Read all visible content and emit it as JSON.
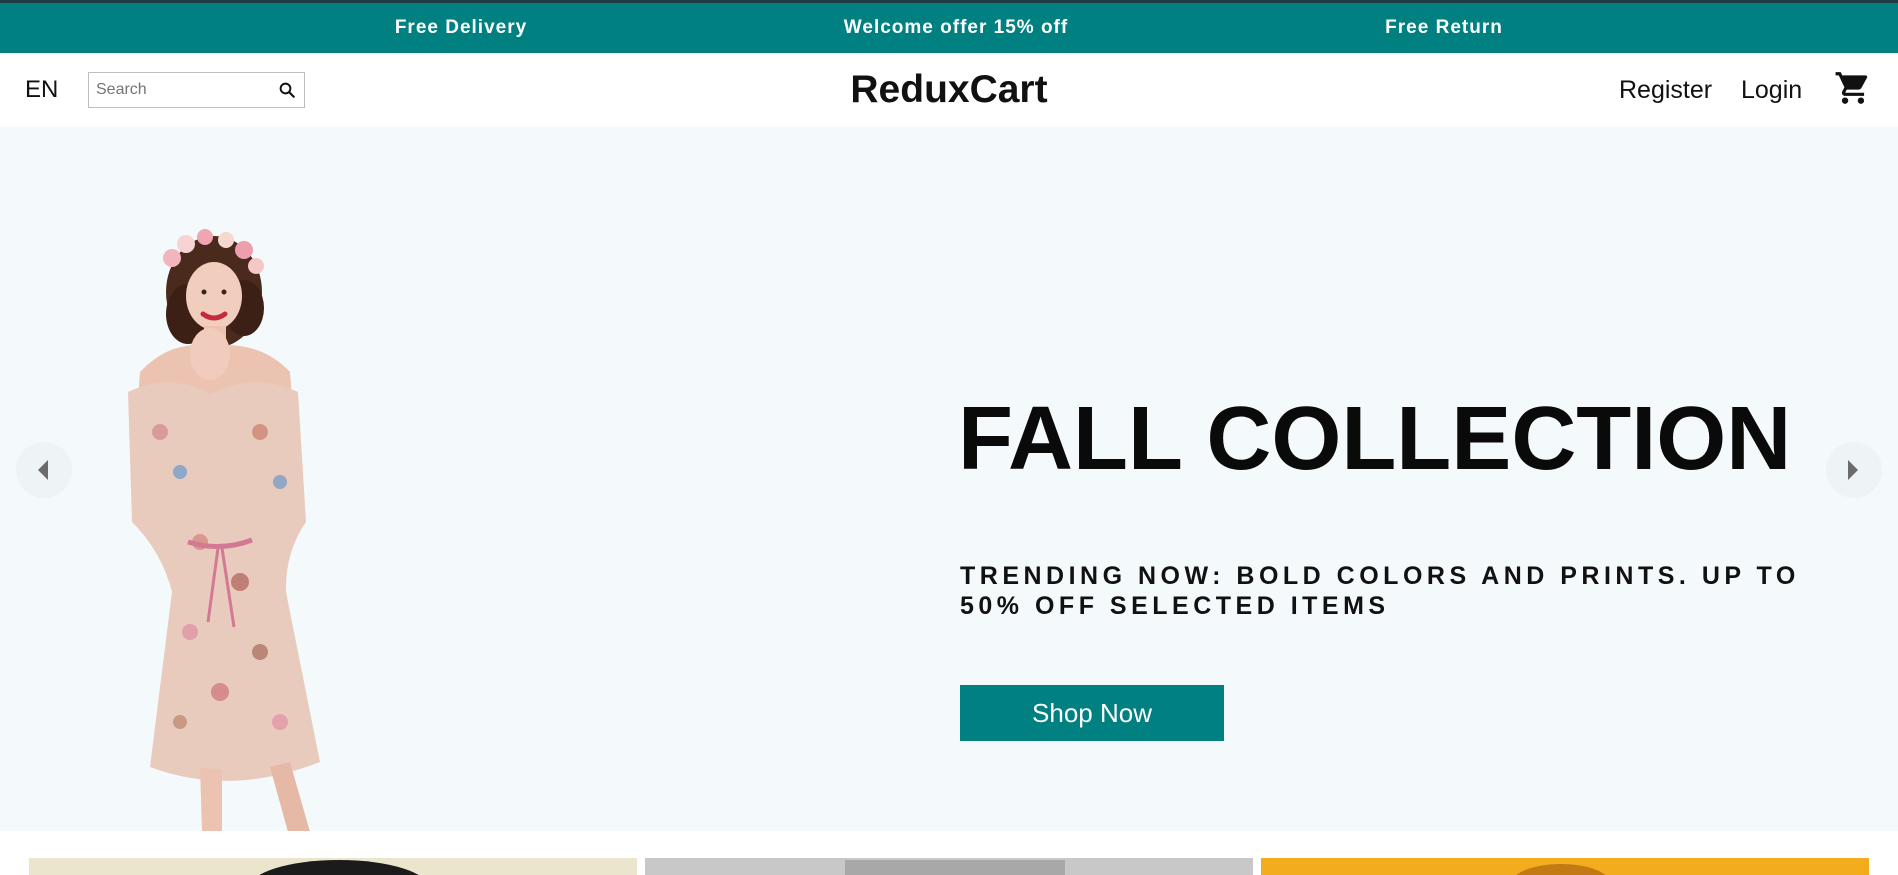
{
  "announcement": {
    "items": [
      "Free Delivery",
      "Welcome offer 15% off",
      "Free Return"
    ]
  },
  "header": {
    "language": "EN",
    "search": {
      "placeholder": "Search",
      "value": ""
    },
    "logo": "ReduxCart",
    "register": "Register",
    "login": "Login",
    "cart_icon": "cart-icon",
    "search_icon": "search-icon"
  },
  "hero": {
    "title": "FALL COLLECTION",
    "description": "TRENDING NOW: BOLD COLORS AND PRINTS. UP TO 50% OFF SELECTED ITEMS",
    "cta_label": "Shop Now",
    "prev_icon": "arrow-left-icon",
    "next_icon": "arrow-right-icon"
  },
  "colors": {
    "accent": "#008080",
    "announce_border": "#1f3d44",
    "hero_background": "#f4f9fb",
    "text": "#111111"
  }
}
